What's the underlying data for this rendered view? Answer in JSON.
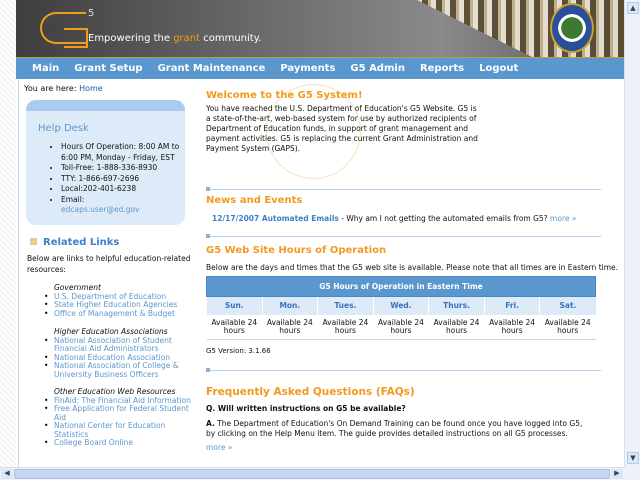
{
  "header": {
    "logo_mark": "G5",
    "tagline_before": "Empowering the ",
    "tagline_accent": "grant",
    "tagline_after": " community."
  },
  "nav": [
    "Main",
    "Grant Setup",
    "Grant Maintenance",
    "Payments",
    "G5 Admin",
    "Reports",
    "Logout"
  ],
  "breadcrumb": {
    "label": "You are here: ",
    "current": "Home"
  },
  "help_desk": {
    "title": "Help Desk",
    "items": [
      "Hours Of Operation: 8:00 AM to 6:00 PM, Monday - Friday, EST",
      "Toll-Free: 1-888-336-8930",
      "TTY: 1-866-697-2696",
      "Local:202-401-6238",
      "Email:"
    ],
    "email": "edcaps.user@ed.gov"
  },
  "related_links": {
    "title": "Related Links",
    "intro": "Below are links to helpful education-related resources:",
    "groups": [
      {
        "name": "Government",
        "links": [
          "U.S. Department of Education",
          "State Higher Education Agencies",
          "Office of Management & Budget"
        ]
      },
      {
        "name": "Higher Education Associations",
        "links": [
          "National Association of Student Financial Aid Administrators",
          "National Education Association",
          "National Association of College & University Business Officers"
        ]
      },
      {
        "name": "Other Education Web Resources",
        "links": [
          "FinAid: The Financial Aid Information",
          "Free Application for Federal Student Aid",
          "National Center for Education Statistics",
          "College Board Online"
        ]
      }
    ]
  },
  "welcome": {
    "title": "Welcome to the G5 System!",
    "text": "You have reached the U.S. Department of Education's G5 Website. G5 is a state-of-the-art, web-based system for use by authorized recipients of Department of Education funds, in support of grant management and payment activities. G5 is replacing the current Grant Administration and Payment System (GAPS)."
  },
  "news": {
    "title": "News and Events",
    "date_title": "12/17/2007 Automated Emails",
    "text": " - Why am I not getting the automated emails from G5? ",
    "more": "more »"
  },
  "hours": {
    "title": "G5 Web Site Hours of Operation",
    "intro": "Below are the days and times that the G5 web site is available. Please note that all times are in Eastern time.",
    "table_caption": "G5 Hours of Operation in Eastern Time",
    "days": [
      "Sun.",
      "Mon.",
      "Tues.",
      "Wed.",
      "Thurs.",
      "Fri.",
      "Sat."
    ],
    "values": [
      "Available 24 hours",
      "Available 24 hours",
      "Available 24 hours",
      "Available 24 hours",
      "Available 24 hours",
      "Available 24 hours",
      "Available 24 hours"
    ],
    "version": "G5 Version: 3.1.66"
  },
  "faq": {
    "title": "Frequently Asked Questions (FAQs)",
    "question": "Q. Will written instructions on G5 be available?",
    "answer_label": "A.",
    "answer": " The Department of Education's On Demand Training can be found once you have logged into G5, by clicking on the Help Menu item. The guide provides detailed instructions on all G5 processes.",
    "more": "more »"
  },
  "colors": {
    "accent": "#f29a1e",
    "nav": "#5b97cf",
    "link": "#5b97cf"
  }
}
